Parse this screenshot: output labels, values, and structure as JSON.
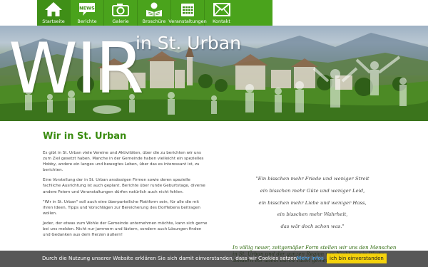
{
  "nav": {
    "items": [
      {
        "label": "Startseite",
        "icon": "home-icon"
      },
      {
        "label": "Berichte",
        "icon": "news-icon",
        "badge": "NEWS"
      },
      {
        "label": "Galerie",
        "icon": "camera-icon"
      },
      {
        "label": "Broschüre",
        "icon": "reader-icon"
      },
      {
        "label": "Veranstaltungen",
        "icon": "calendar-icon"
      },
      {
        "label": "Kontakt",
        "icon": "mail-icon"
      }
    ],
    "active_index": 0,
    "colors": {
      "bar": "#4aa31c",
      "active": "#3f8f17"
    }
  },
  "banner": {
    "big_text": "WIR",
    "sub_text": "in St. Urban"
  },
  "main": {
    "title": "Wir in St. Urban",
    "paragraphs": [
      "Es gibt in St. Urban viele Vereine und Aktivitäten, über die zu berichten wir uns zum Ziel gesetzt haben. Manche in der Gemeinde haben vielleicht ein spezielles Hobby, andere ein langes und bewegtes Leben, über das es interessant ist, zu berichten.",
      "Eine Vorstellung der in St. Urban ansässigen Firmen sowie deren spezielle fachliche Ausrichtung ist auch geplant. Berichte über runde Geburtstage, diverse andere Feiern und Veranstaltungen dürfen natürlich auch nicht fehlen.",
      "\"Wir in St. Urban\" soll auch eine überparteiliche Plattform sein, für alle die mit ihren Ideen, Tipps und Vorschlägen zur Bereicherung des Dorflebens beitragen wollen.",
      "Jeder, der etwas zum Wohle der Gemeinde unternehmen möchte, kann sich gerne bei uns melden. Nicht nur jammern und lästern, sondern auch Lösungen finden und Gedanken aus dem Herzen äußern!"
    ],
    "quote_lines": [
      "\"Ein bisschen mehr Friede und weniger Streit",
      "ein bisschen mehr Güte  und weniger Leid,",
      "ein bisschen mehr Liebe und weniger Hass,",
      "ein bisschen mehr Wahrheit,",
      "das wär doch schon was.\""
    ],
    "intro": "In völlig neuer, zeitgemäßer Form stellen wir uns den Menschen in St. Urban und der ganzen Region vor. Nicht nur in Worte, sondern vor allem durch Taten gemeinsam und"
  },
  "cookie": {
    "text": "Durch die Nutzung unserer Website erklären Sie sich damit einverstanden, dass wir Cookies setzen.",
    "link": "Mehr Infos",
    "button": "ich bin einverstanden"
  }
}
